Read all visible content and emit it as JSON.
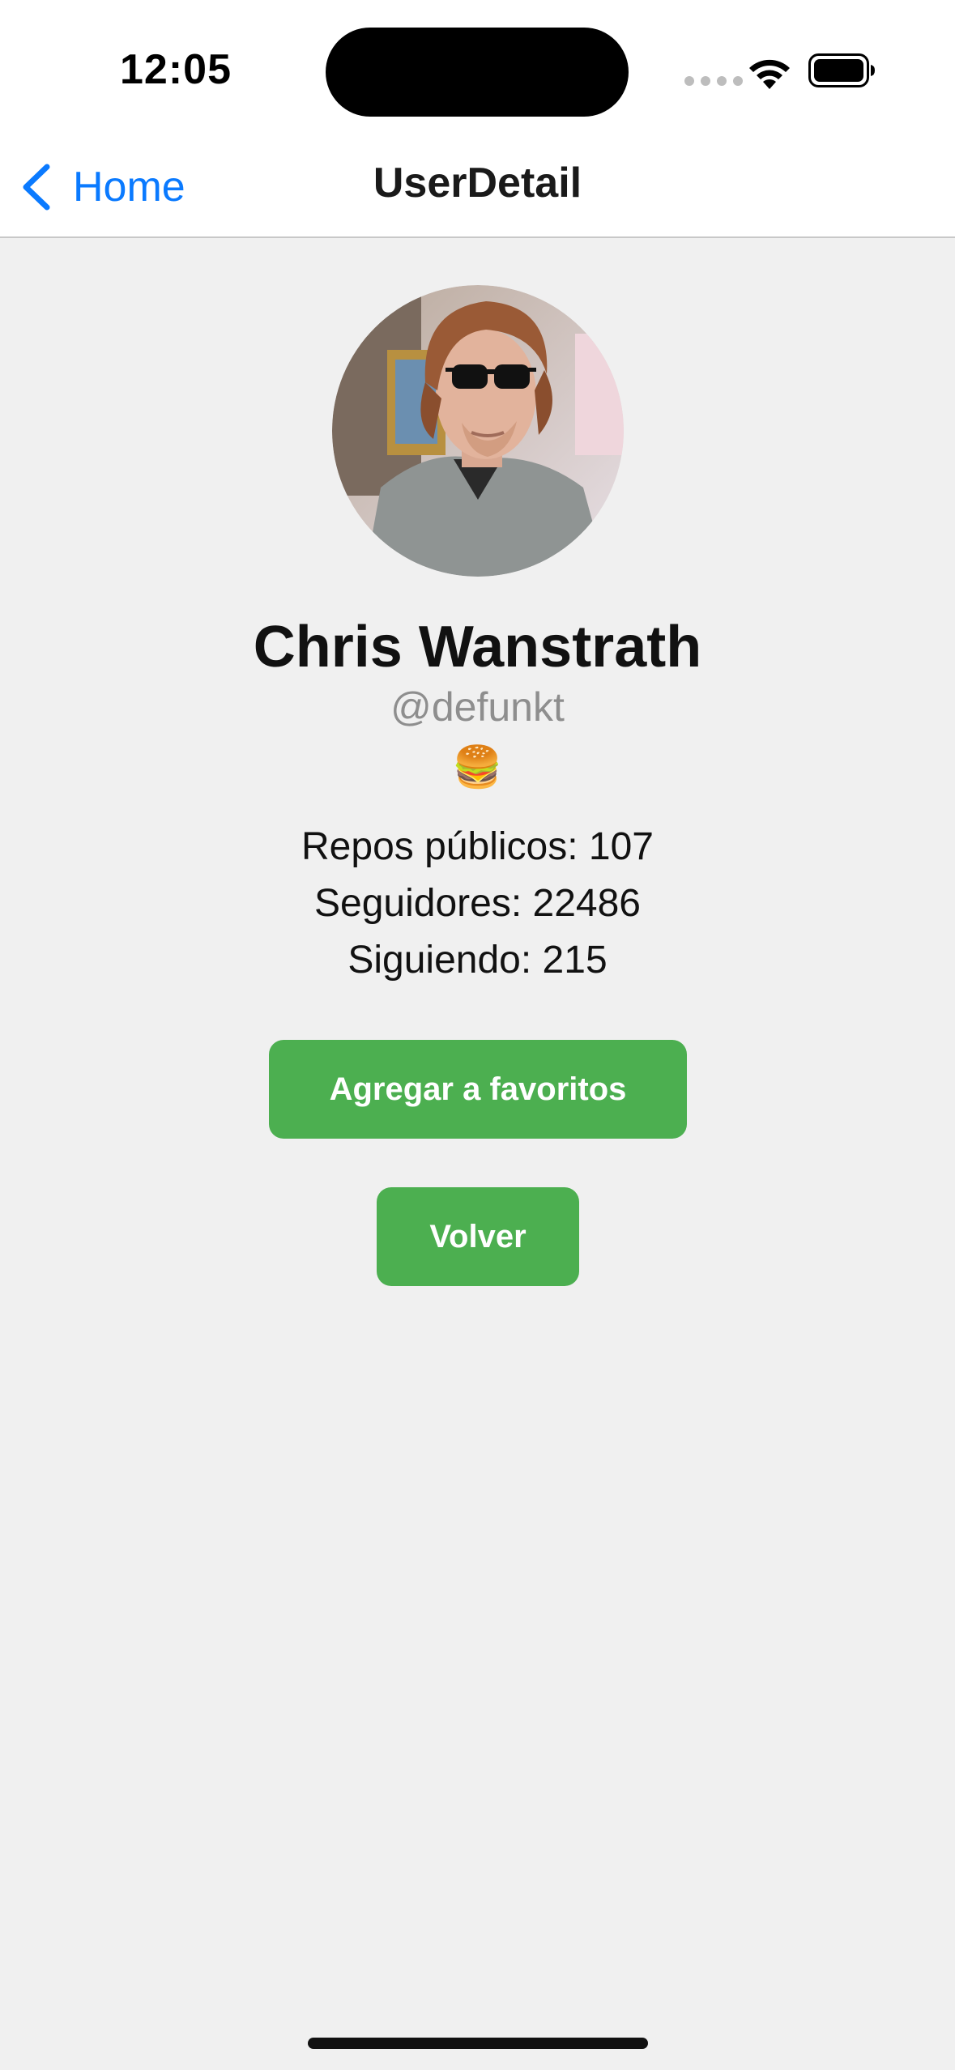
{
  "status_bar": {
    "time": "12:05",
    "icons": [
      "signal-dots-icon",
      "wifi-icon",
      "battery-icon"
    ]
  },
  "nav": {
    "back_label": "Home",
    "back_icon": "chevron-left-icon",
    "title": "UserDetail"
  },
  "profile": {
    "avatar_icon": "user-avatar-photo",
    "name": "Chris Wanstrath",
    "username": "@defunkt",
    "bio": "🍔",
    "stats": {
      "repos": "Repos públicos: 107",
      "followers": "Seguidores: 22486",
      "following": "Siguiendo: 215"
    }
  },
  "actions": {
    "favorite_label": "Agregar a favoritos",
    "back_label": "Volver"
  },
  "colors": {
    "accent_link": "#0a7aff",
    "button_green": "#4caf50",
    "background": "#f0f0f0",
    "nav_background": "#ffffff"
  }
}
